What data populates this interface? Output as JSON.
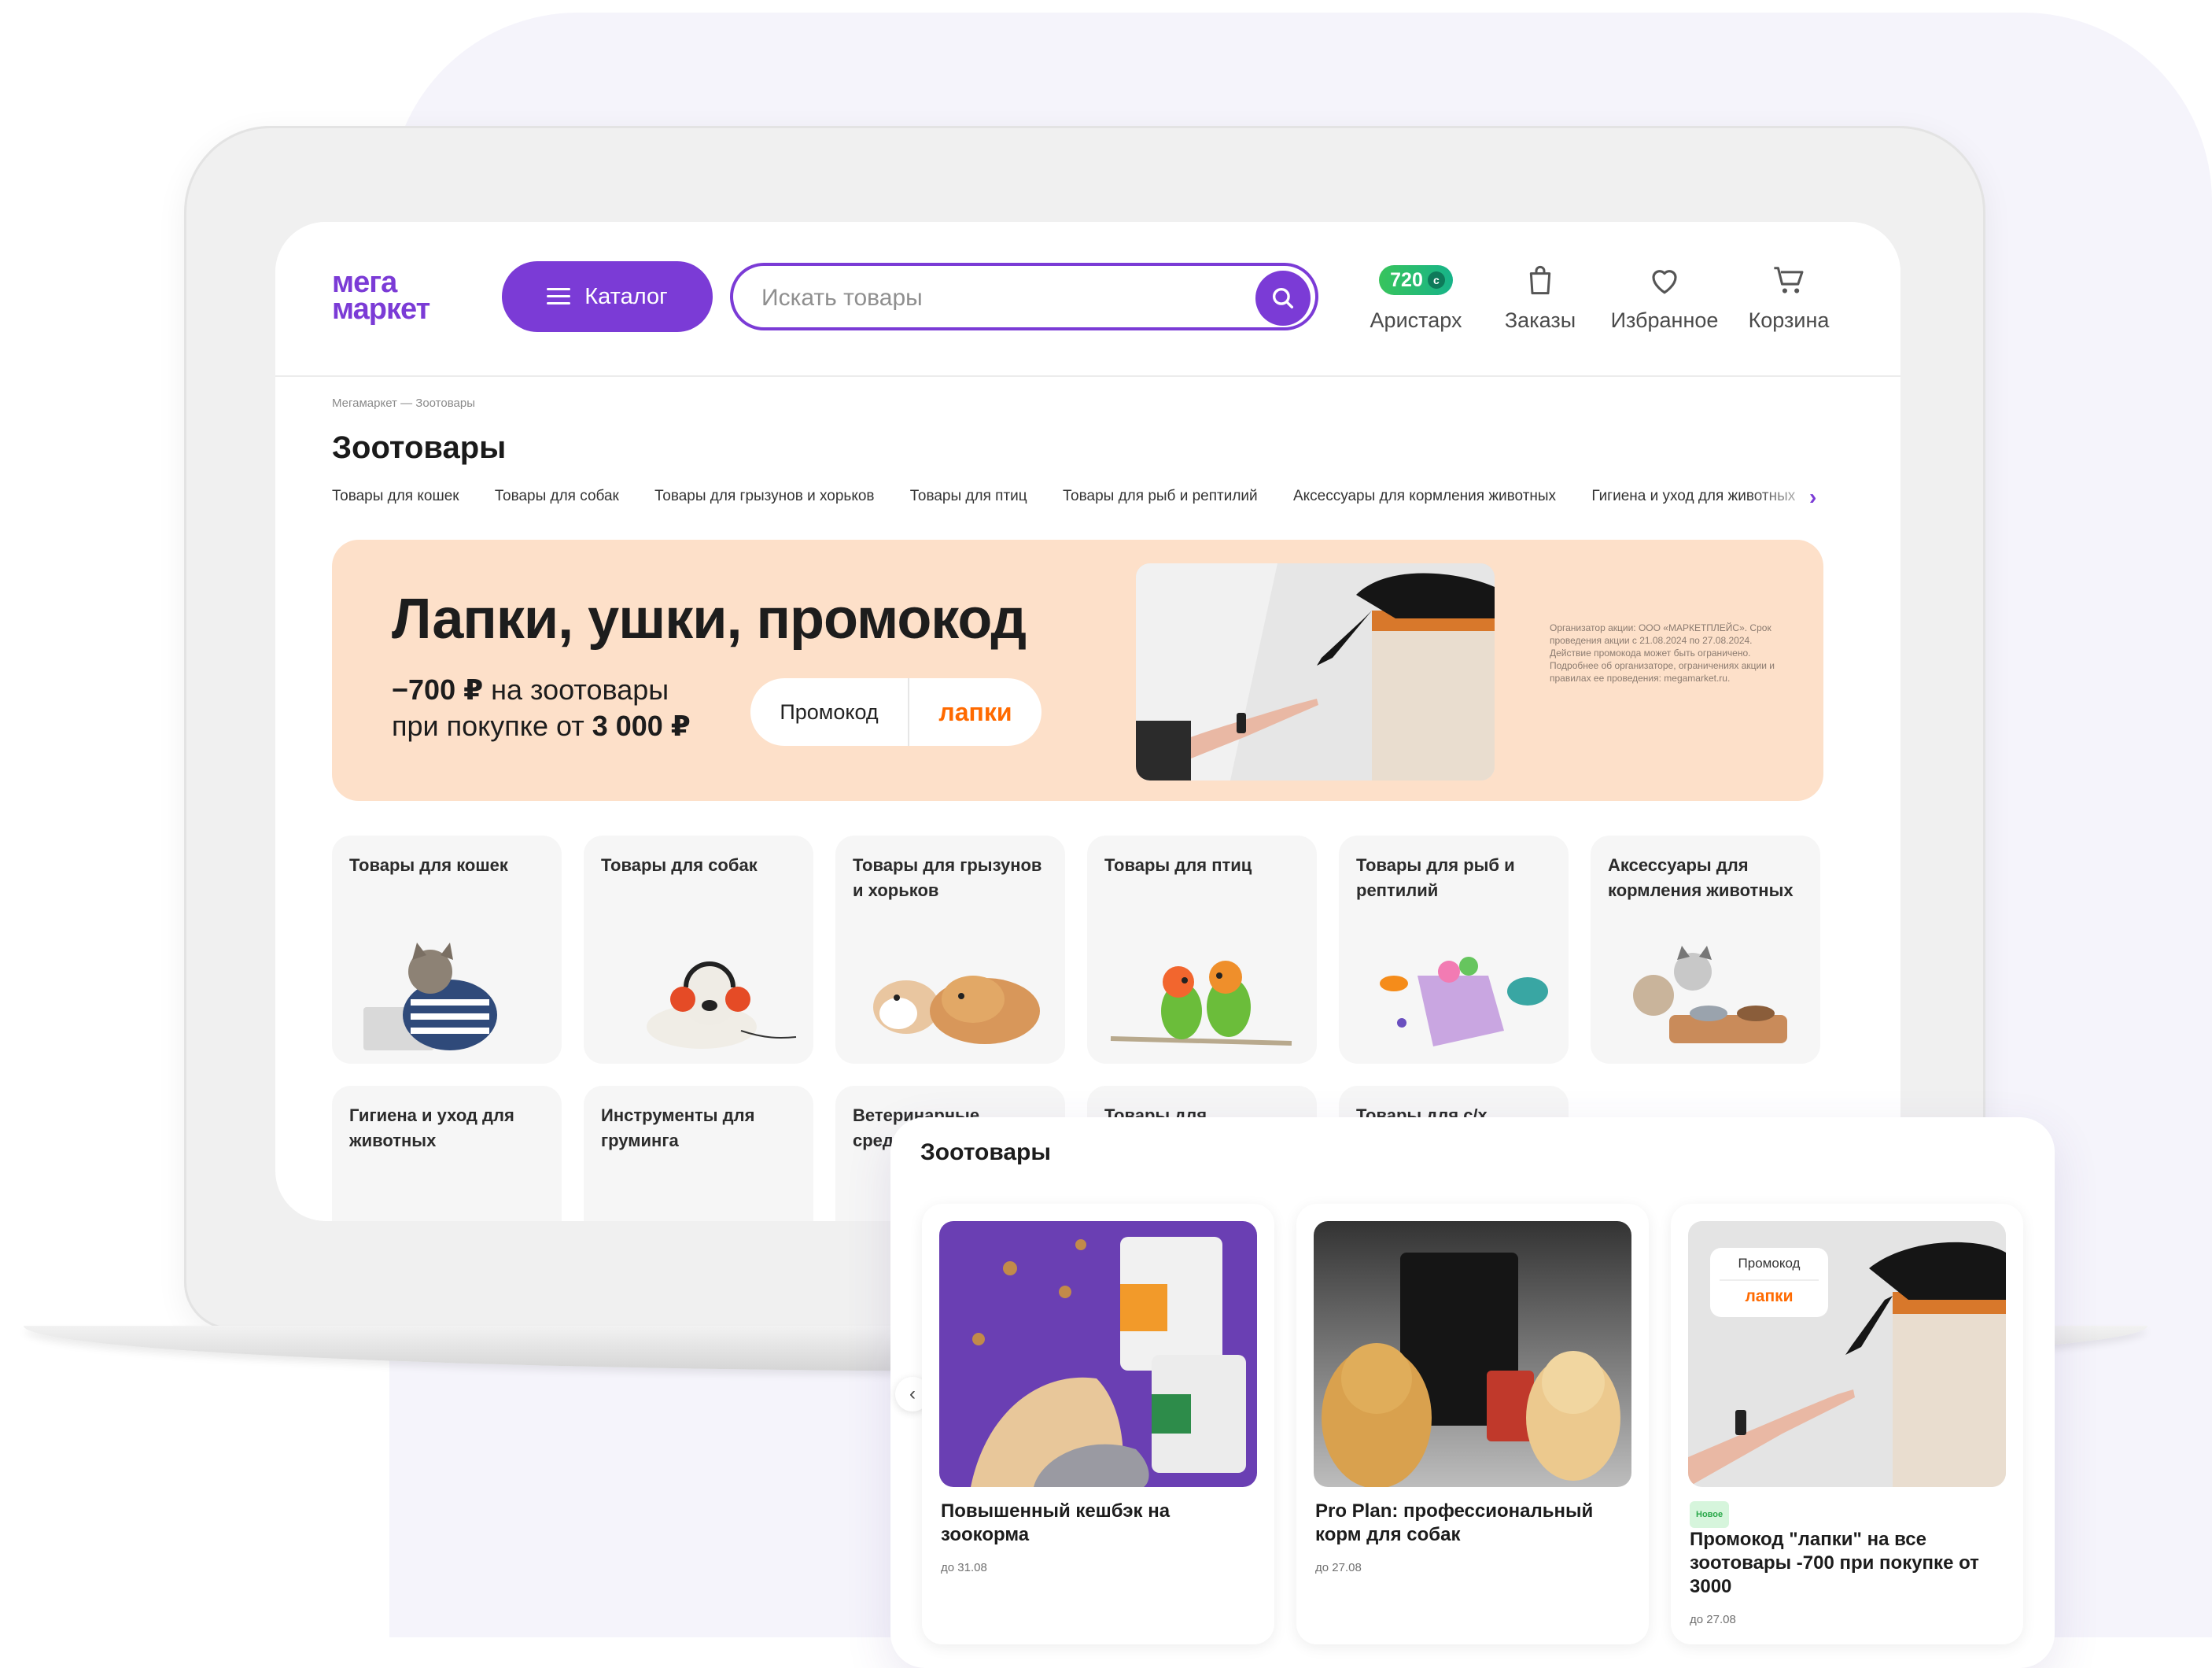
{
  "logo": {
    "line1": "мега",
    "line2": "маркет"
  },
  "header": {
    "catalog_label": "Каталог",
    "search_placeholder": "Искать товары",
    "bonus_points": "720",
    "nav": [
      {
        "label": "Аристарх",
        "icon": "user-bonus-icon"
      },
      {
        "label": "Заказы",
        "icon": "bag-icon"
      },
      {
        "label": "Избранное",
        "icon": "heart-icon"
      },
      {
        "label": "Корзина",
        "icon": "cart-icon"
      }
    ]
  },
  "breadcrumb": "Мегамаркет — Зоотовары",
  "page_title": "Зоотовары",
  "category_tabs": [
    "Товары для кошек",
    "Товары для собак",
    "Товары для грызунов и хорьков",
    "Товары для птиц",
    "Товары для рыб и рептилий",
    "Аксессуары для кормления животных",
    "Гигиена и уход для животных"
  ],
  "promo": {
    "title": "Лапки, ушки, промокод",
    "discount": "−700 ₽",
    "discount_text": " на зоотовары",
    "condition_text": "при покупке от ",
    "condition_amount": "3 000 ₽",
    "code_label": "Промокод",
    "code": "лапки",
    "legal": "Организатор акции: ООО «МАРКЕТПЛЕЙС». Срок проведения акции с 21.08.2024 по 27.08.2024. Действие промокода может быть ограничено. Подробнее об организаторе, ограничениях акции и правилах ее проведения: megamarket.ru."
  },
  "tiles": [
    {
      "label": "Товары для кошек"
    },
    {
      "label": "Товары для собак"
    },
    {
      "label": "Товары для грызунов и хорьков"
    },
    {
      "label": "Товары для птиц"
    },
    {
      "label": "Товары для рыб и рептилий"
    },
    {
      "label": "Аксессуары для кормления животных"
    },
    {
      "label": "Гигиена и уход для животных"
    },
    {
      "label": "Инструменты для груминга"
    },
    {
      "label": "Ветеринарные средства"
    },
    {
      "label": "Товары для"
    },
    {
      "label": "Товары для с/х"
    }
  ],
  "overlay": {
    "title": "Зоотовары",
    "cards": [
      {
        "name": "Повышенный кешбэк на зоокорма",
        "date": "до 31.08"
      },
      {
        "name": "Pro Plan: профессиональный корм для собак",
        "date": "до 27.08"
      },
      {
        "badge": "Новое",
        "name": "Промокод \"лапки\" на все зоотовары -700 при покупке от 3000",
        "date": "до 27.08",
        "chip_label": "Промокод",
        "chip_code": "лапки"
      }
    ]
  },
  "colors": {
    "brand": "#7b3bd6",
    "promo_bg": "#fde0c9",
    "accent_orange": "#ff6a00",
    "bonus_green": "#2bbd6e"
  }
}
